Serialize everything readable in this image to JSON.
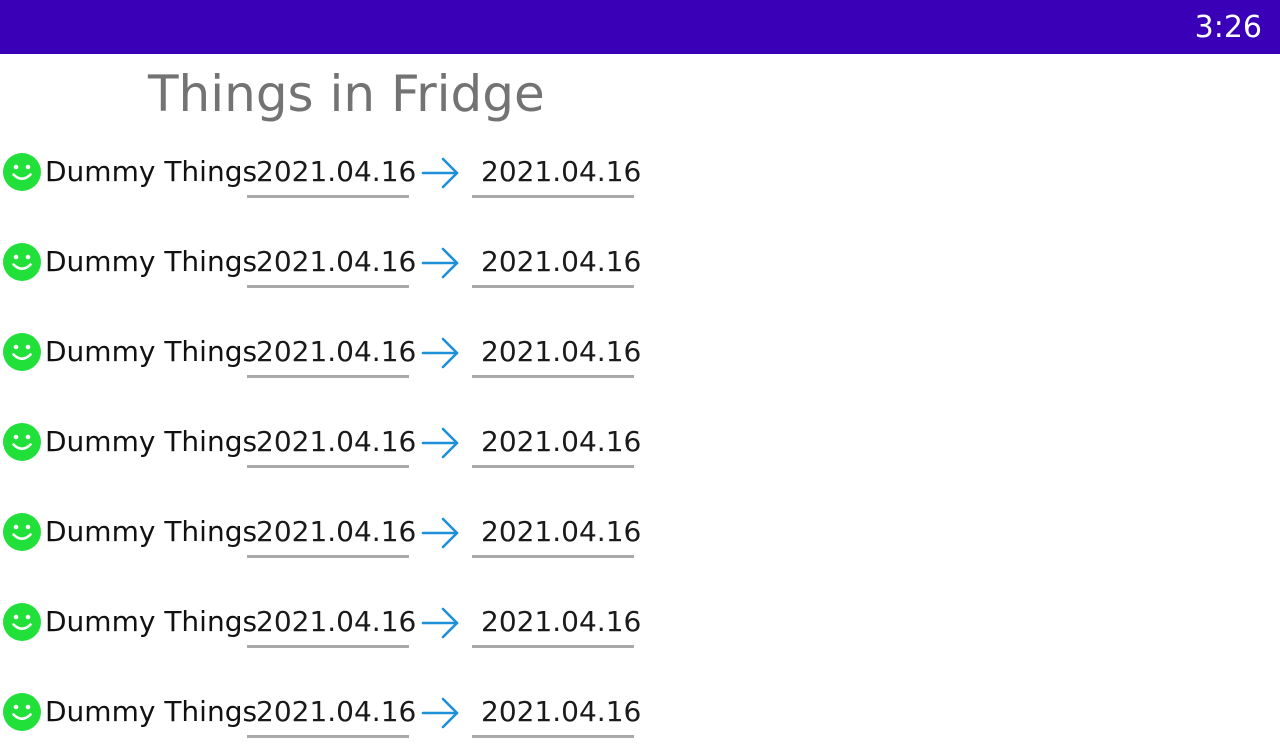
{
  "status_bar": {
    "time": "3:26",
    "color": "#3a00b8"
  },
  "title": "Things in Fridge",
  "items": [
    {
      "name": "Dummy Things",
      "start_date": "2021.04.16",
      "end_date": "2021.04.16",
      "status_icon": "smile-face-icon",
      "status_color": "#22e03a"
    },
    {
      "name": "Dummy Things",
      "start_date": "2021.04.16",
      "end_date": "2021.04.16",
      "status_icon": "smile-face-icon",
      "status_color": "#22e03a"
    },
    {
      "name": "Dummy Things",
      "start_date": "2021.04.16",
      "end_date": "2021.04.16",
      "status_icon": "smile-face-icon",
      "status_color": "#22e03a"
    },
    {
      "name": "Dummy Things",
      "start_date": "2021.04.16",
      "end_date": "2021.04.16",
      "status_icon": "smile-face-icon",
      "status_color": "#22e03a"
    },
    {
      "name": "Dummy Things",
      "start_date": "2021.04.16",
      "end_date": "2021.04.16",
      "status_icon": "smile-face-icon",
      "status_color": "#22e03a"
    },
    {
      "name": "Dummy Things",
      "start_date": "2021.04.16",
      "end_date": "2021.04.16",
      "status_icon": "smile-face-icon",
      "status_color": "#22e03a"
    },
    {
      "name": "Dummy Things",
      "start_date": "2021.04.16",
      "end_date": "2021.04.16",
      "status_icon": "smile-face-icon",
      "status_color": "#22e03a"
    }
  ],
  "colors": {
    "arrow": "#1e90d8",
    "title": "#737373"
  }
}
